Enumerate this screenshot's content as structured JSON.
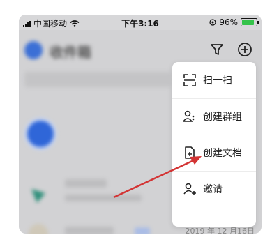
{
  "status_bar": {
    "carrier": "中国移动",
    "time": "下午3:16",
    "battery_percent": "96%",
    "battery_level": 0.96
  },
  "header": {
    "title": "收件箱"
  },
  "menu": {
    "items": [
      {
        "label": "扫一扫",
        "icon": "scan-icon"
      },
      {
        "label": "创建群组",
        "icon": "group-icon"
      },
      {
        "label": "创建文档",
        "icon": "document-add-icon"
      },
      {
        "label": "邀请",
        "icon": "invite-user-icon"
      }
    ]
  },
  "chat_list": {
    "date": "2019 年 12 月16日"
  },
  "colors": {
    "accent": "#3b6fd6",
    "annotation_arrow": "#d33434",
    "battery": "#35c34a"
  }
}
